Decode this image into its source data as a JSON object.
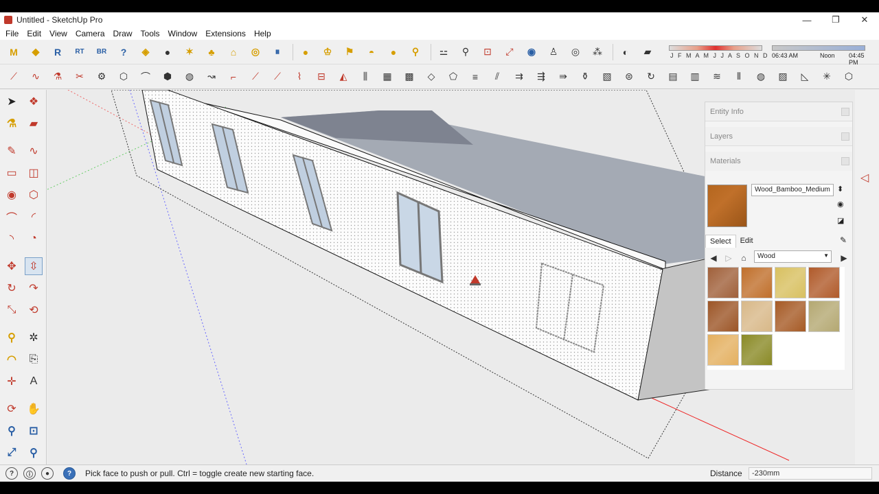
{
  "window": {
    "title": "Untitled - SketchUp Pro",
    "controls": [
      "—",
      "❐",
      "✕"
    ]
  },
  "menu": [
    "File",
    "Edit",
    "View",
    "Camera",
    "Draw",
    "Tools",
    "Window",
    "Extensions",
    "Help"
  ],
  "toolbar1": {
    "plugin_buttons": [
      {
        "icon": "m-plugin-icon",
        "glyph": "M"
      },
      {
        "icon": "tag-plugin-icon",
        "glyph": "◆"
      },
      {
        "icon": "r-plugin-icon",
        "glyph": "R"
      },
      {
        "icon": "rt-plugin-icon",
        "glyph": "RT"
      },
      {
        "icon": "br-plugin-icon",
        "glyph": "BR"
      },
      {
        "icon": "help-plugin-icon",
        "glyph": "?"
      }
    ]
  },
  "shadow": {
    "months": "J F M A M J J A S O N D",
    "time_start": "06:43 AM",
    "time_noon": "Noon",
    "time_end": "04:45 PM"
  },
  "tray": {
    "entity_info_label": "Entity Info",
    "layers_label": "Layers",
    "materials_label": "Materials",
    "material_name": "Wood_Bamboo_Medium",
    "tab_select": "Select",
    "tab_edit": "Edit",
    "collection": "Wood",
    "swatch_colors": [
      "#a0603a",
      "#c06f2b",
      "#d8c060",
      "#b05a2a",
      "#9c5526",
      "#d8b888",
      "#a65a25",
      "#b4a872",
      "#e4b060",
      "#8a8a26"
    ]
  },
  "status": {
    "hint": "Pick face to push or pull.  Ctrl = toggle create new starting face.",
    "measure_label": "Distance",
    "measure_value": "-230mm"
  }
}
